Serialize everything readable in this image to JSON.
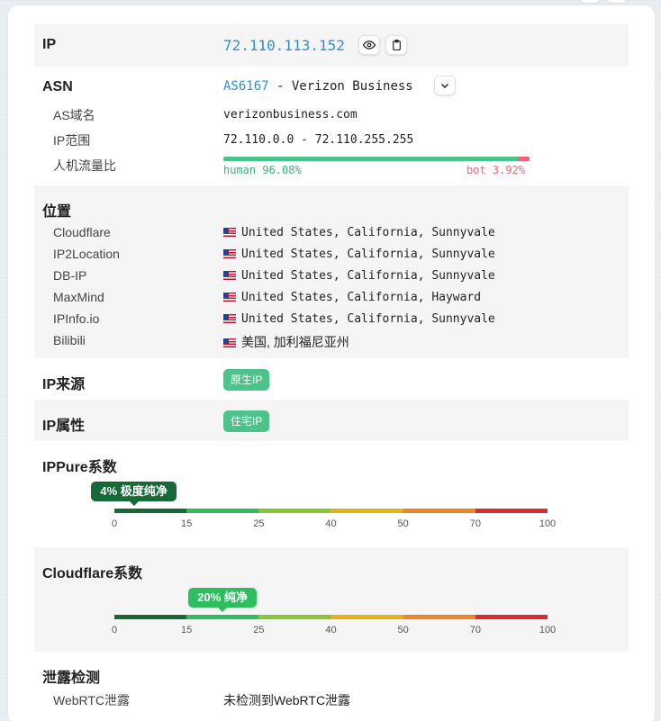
{
  "ip": {
    "label": "IP",
    "value": "72.110.113.152"
  },
  "asn": {
    "label": "ASN",
    "number": "AS6167",
    "name": " - Verizon Business",
    "domain_label": "AS域名",
    "domain": "verizonbusiness.com",
    "range_label": "IP范围",
    "range": "72.110.0.0 - 72.110.255.255",
    "traffic_label": "人机流量比",
    "human_text": "human 96.08%",
    "bot_text": "bot 3.92%",
    "human_pct": 96.08,
    "bot_pct": 3.92
  },
  "location": {
    "label": "位置",
    "rows": [
      {
        "source": "Cloudflare",
        "value": "United States, California, Sunnyvale"
      },
      {
        "source": "IP2Location",
        "value": "United States, California, Sunnyvale"
      },
      {
        "source": "DB-IP",
        "value": "United States, California, Sunnyvale"
      },
      {
        "source": "MaxMind",
        "value": "United States, California, Hayward"
      },
      {
        "source": "IPInfo.io",
        "value": "United States, California, Sunnyvale"
      },
      {
        "source": "Bilibili",
        "value": "美国, 加利福尼亚州"
      }
    ]
  },
  "ip_source": {
    "label": "IP来源",
    "badge": "原生IP"
  },
  "ip_attr": {
    "label": "IP属性",
    "badge": "住宅IP"
  },
  "ippure": {
    "label": "IPPure系数",
    "marker": "4% 极度纯净",
    "value": 4
  },
  "cloudflare_score": {
    "label": "Cloudflare系数",
    "marker": "20% 纯净",
    "value": 20
  },
  "scale": {
    "ticks": [
      "0",
      "15",
      "25",
      "40",
      "50",
      "70",
      "100"
    ],
    "colors": [
      "#166a37",
      "#2ebd5f",
      "#88c630",
      "#e5b113",
      "#f08424",
      "#d92c2c"
    ]
  },
  "leak": {
    "label": "泄露检测",
    "webrtc_label": "WebRTC泄露",
    "webrtc_value": "未检测到WebRTC泄露"
  },
  "colors": {
    "accent": "#2d8fd5",
    "badge": "#4cc38a",
    "human": "#4cc38a",
    "bot": "#f0637b",
    "marker_dark": "#166a37",
    "marker_green": "#2ebd5f"
  }
}
